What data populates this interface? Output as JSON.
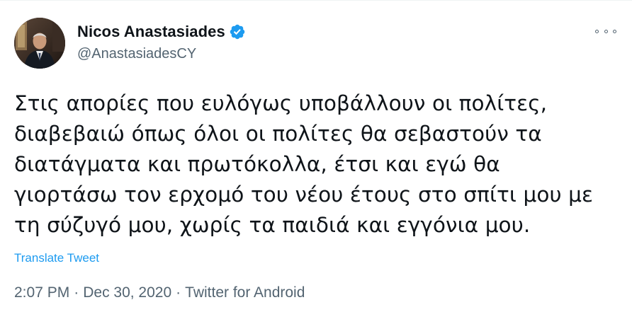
{
  "author": {
    "display_name": "Nicos Anastasiades",
    "handle": "@AnastasiadesCY",
    "verified": true,
    "avatar_icon": "profile-photo"
  },
  "tweet": {
    "lines": [
      "Στις απορίες που ευλόγως υποβάλλουν οι πολίτες,",
      "διαβεβαιώ όπως όλοι οι πολίτες θα σεβαστούν τα",
      "διατάγματα και πρωτόκολλα, έτσι και εγώ θα",
      "γιορτάσω τον ερχομό του νέου έτους στο σπίτι μου με",
      "τη σύζυγό μου, χωρίς τα παιδιά και εγγόνια μου."
    ],
    "translate_label": "Translate Tweet",
    "time": "2:07 PM",
    "separator": "·",
    "date": "Dec 30, 2020",
    "source": "Twitter for Android"
  },
  "icons": {
    "more": "more-horizontal-icon",
    "verified": "verified-badge-icon"
  },
  "colors": {
    "text": "#0f1419",
    "secondary": "#536471",
    "link": "#1d9bf0",
    "verified": "#1d9bf0"
  }
}
